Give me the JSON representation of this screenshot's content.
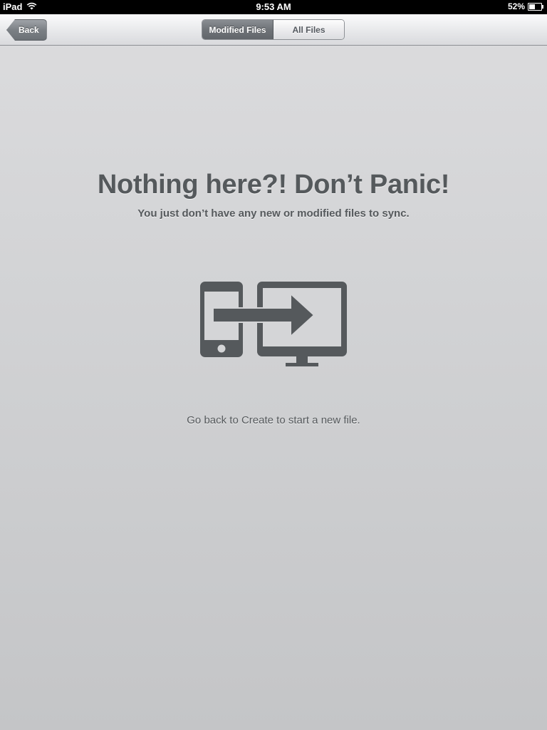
{
  "status_bar": {
    "device": "iPad",
    "time": "9:53 AM",
    "battery_percent": "52%",
    "battery_level": 0.52
  },
  "nav": {
    "back_label": "Back",
    "segments": [
      {
        "label": "Modified Files",
        "selected": true
      },
      {
        "label": "All Files",
        "selected": false
      }
    ]
  },
  "empty_state": {
    "headline": "Nothing here?! Don’t Panic!",
    "subheadline": "You just don’t have any new or modified files to sync.",
    "illustration": "phone-to-desktop-sync-icon",
    "footer": "Go back to Create to start a new file."
  },
  "colors": {
    "text": "#55595c",
    "icon": "#55595c",
    "background_top": "#dcdcde",
    "background_bottom": "#c4c5c7"
  }
}
